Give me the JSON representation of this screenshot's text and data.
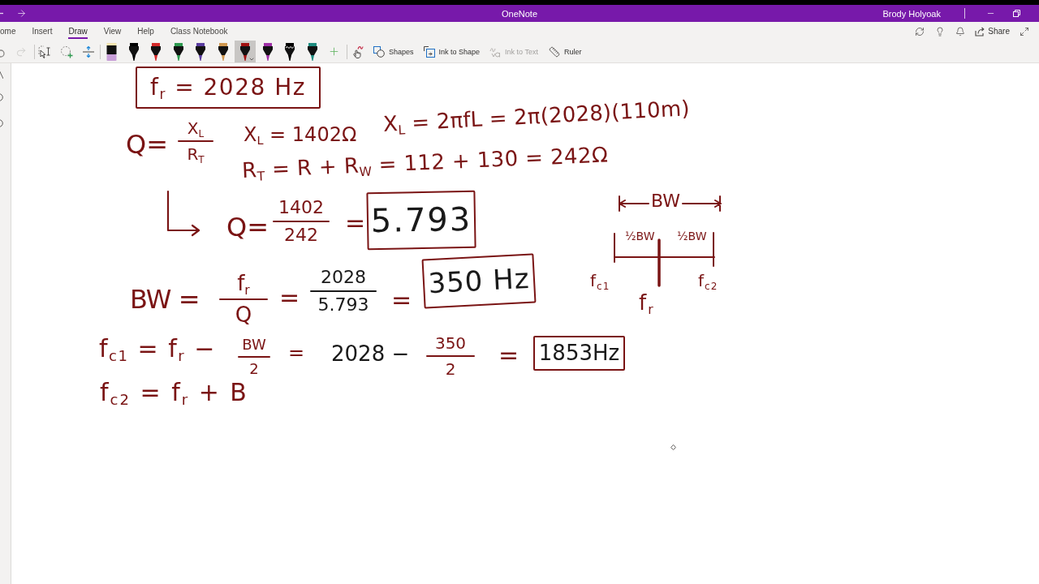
{
  "title_bar": {
    "title": "OneNote",
    "user": "Brody Holyoak"
  },
  "ribbon": {
    "tabs": [
      {
        "label": "ome",
        "selected": false
      },
      {
        "label": "Insert",
        "selected": false
      },
      {
        "label": "Draw",
        "selected": true
      },
      {
        "label": "View",
        "selected": false
      },
      {
        "label": "Help",
        "selected": false
      },
      {
        "label": "Class Notebook",
        "selected": false
      }
    ],
    "share": "Share",
    "undo": {
      "disabled": false
    },
    "redo": {
      "disabled": true
    },
    "pens": [
      {
        "kind": "marker",
        "color": "#c89ed8",
        "selected": false
      },
      {
        "kind": "pen",
        "color": "#000000",
        "selected": false
      },
      {
        "kind": "pen",
        "color": "#d42a2a",
        "selected": false
      },
      {
        "kind": "pen",
        "color": "#2e9a50",
        "selected": false
      },
      {
        "kind": "pen",
        "color": "#5a3ca0",
        "selected": false
      },
      {
        "kind": "pen",
        "color": "#d09850",
        "selected": false
      },
      {
        "kind": "pen",
        "color": "#a01010",
        "selected": true
      },
      {
        "kind": "pen",
        "color": "#a030a8",
        "selected": false
      },
      {
        "kind": "patterned",
        "color": "#000000",
        "selected": false
      },
      {
        "kind": "pen",
        "color": "#1e8c80",
        "selected": false
      }
    ],
    "tools": [
      {
        "label": "Shapes",
        "disabled": false
      },
      {
        "label": "Ink to Shape",
        "disabled": false
      },
      {
        "label": "Ink to Text",
        "disabled": true
      },
      {
        "label": "Ruler",
        "disabled": false
      }
    ]
  },
  "page": {
    "ink": [
      {
        "kind": "boxed",
        "text": "f$_{r}$ = 2028 Hz",
        "color": "#7a1414"
      },
      {
        "kind": "text",
        "text": "Q =",
        "color": "#7a1414"
      },
      {
        "kind": "fraction",
        "numerator": "X$_{L}$",
        "denominator": "R$_{T}$",
        "color": "#7a1414"
      },
      {
        "kind": "text",
        "text": "X$_{L}$ = 1402Ω",
        "color": "#7a1414"
      },
      {
        "kind": "text",
        "text": "X$_{L}$ = 2πfL = 2π(2028)(110m)",
        "color": "#7a1414"
      },
      {
        "kind": "text",
        "text": "R$_{T}$ = R + R$_{W}$ = 112 + 130 = 242Ω",
        "color": "#7a1414"
      },
      {
        "kind": "arrow",
        "color": "#7a1414"
      },
      {
        "kind": "text",
        "text": "Q =",
        "color": "#7a1414"
      },
      {
        "kind": "fraction",
        "numerator": "1402",
        "denominator": "242",
        "color": "#7a1414"
      },
      {
        "kind": "text",
        "text": "=",
        "color": "#7a1414"
      },
      {
        "kind": "boxed",
        "text": "5.793",
        "color": "#1a1a1a"
      },
      {
        "kind": "text",
        "text": "BW =",
        "color": "#7a1414"
      },
      {
        "kind": "fraction",
        "numerator": "f$_{r}$",
        "denominator": "Q",
        "color": "#7a1414"
      },
      {
        "kind": "text",
        "text": "=",
        "color": "#7a1414"
      },
      {
        "kind": "fraction",
        "numerator": "2028",
        "denominator": "5.793",
        "color": "#1a1a1a"
      },
      {
        "kind": "text",
        "text": "=",
        "color": "#7a1414"
      },
      {
        "kind": "boxed",
        "text": "350 Hz",
        "color": "#1a1a1a"
      },
      {
        "kind": "text",
        "text": "f$_{c1}$ = f$_{r}$ −",
        "color": "#7a1414"
      },
      {
        "kind": "fraction",
        "numerator": "BW",
        "denominator": "2",
        "color": "#7a1414"
      },
      {
        "kind": "text",
        "text": "=",
        "color": "#7a1414"
      },
      {
        "kind": "text",
        "text": "2028 −",
        "color": "#1a1a1a"
      },
      {
        "kind": "fraction",
        "numerator": "350",
        "denominator": "2",
        "color": "#7a1414"
      },
      {
        "kind": "text",
        "text": "=",
        "color": "#7a1414"
      },
      {
        "kind": "boxed",
        "text": "1853Hz",
        "color": "#1a1a1a"
      },
      {
        "kind": "text",
        "text": "f$_{c2}$ = f$_{r}$ + B",
        "color": "#7a1414"
      }
    ],
    "diagram": {
      "span_label": "BW",
      "half_labels": [
        "½BW",
        "½BW"
      ],
      "end_labels": [
        "f$_{c1}$",
        "f$_{c2}$"
      ],
      "center_label": "f$_{r}$"
    }
  }
}
